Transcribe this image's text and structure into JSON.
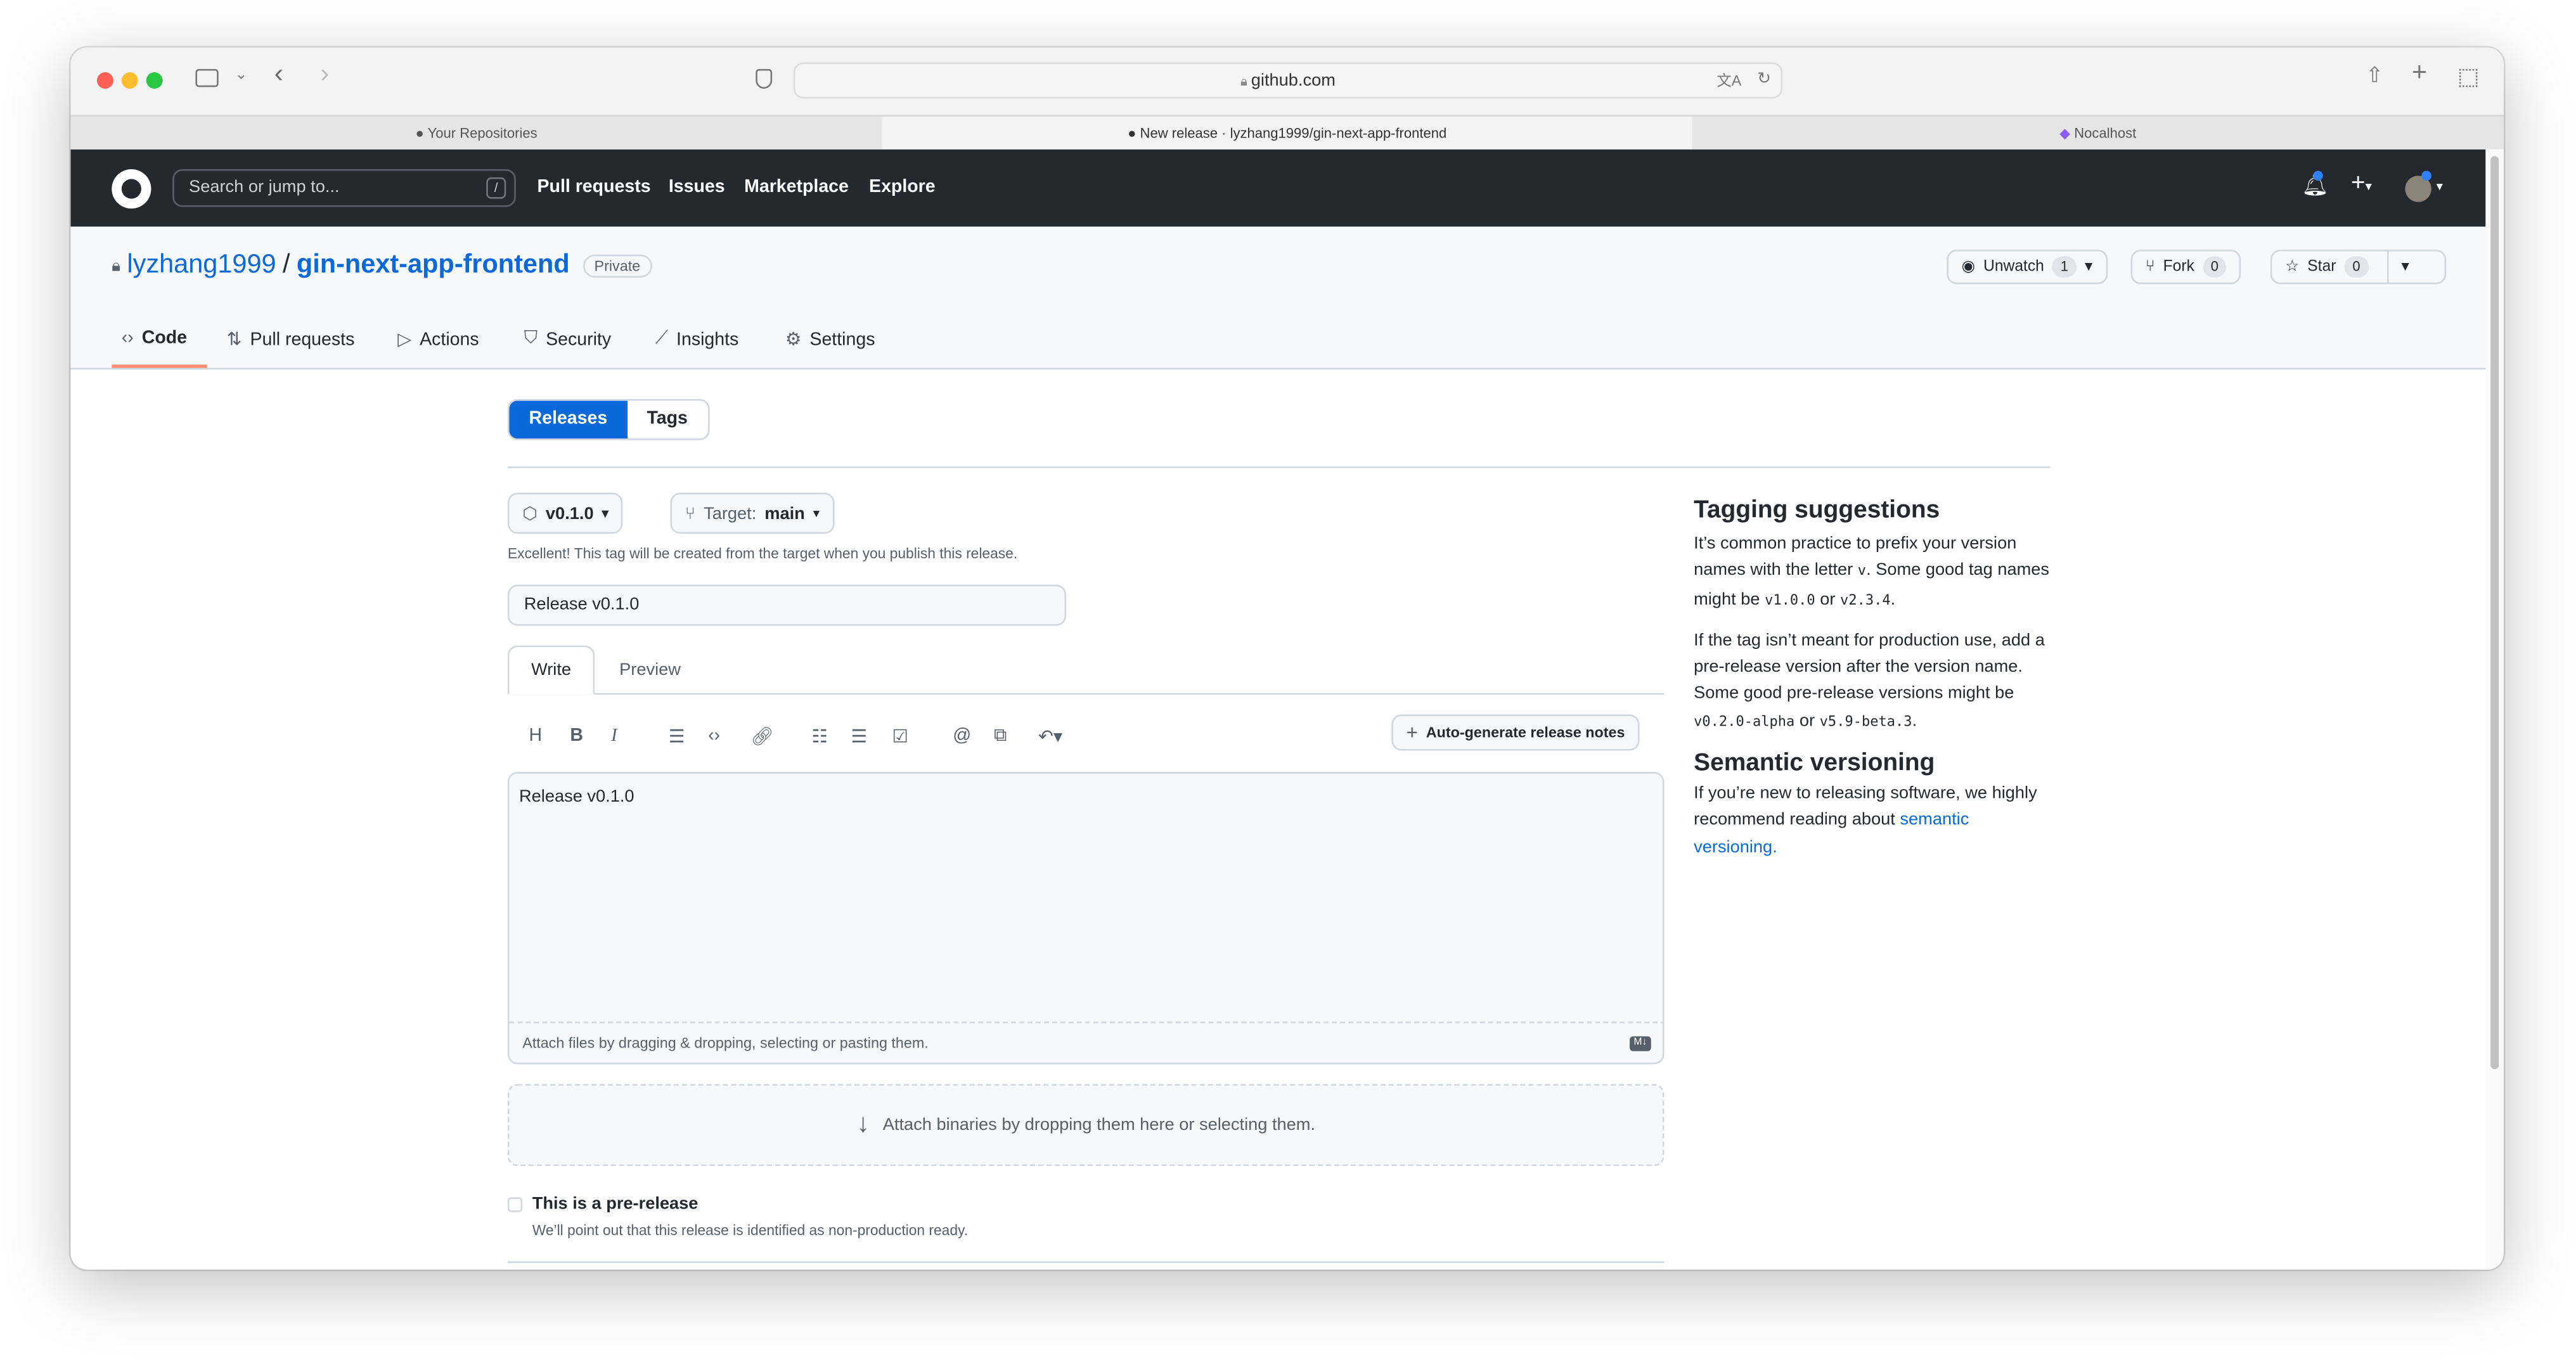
{
  "browser": {
    "url": "github.com",
    "tabs": [
      {
        "label": "Your Repositories"
      },
      {
        "label": "New release · lyzhang1999/gin-next-app-frontend",
        "active": true
      },
      {
        "label": "Nocalhost"
      }
    ]
  },
  "header": {
    "search_placeholder": "Search or jump to...",
    "slash": "/",
    "nav": [
      "Pull requests",
      "Issues",
      "Marketplace",
      "Explore"
    ]
  },
  "repo": {
    "owner": "lyzhang1999",
    "sep": "/",
    "name": "gin-next-app-frontend",
    "visibility": "Private",
    "unwatch": {
      "label": "Unwatch",
      "count": "1"
    },
    "fork": {
      "label": "Fork",
      "count": "0"
    },
    "star": {
      "label": "Star",
      "count": "0"
    },
    "tabs": [
      "Code",
      "Pull requests",
      "Actions",
      "Security",
      "Insights",
      "Settings"
    ],
    "active_tab": "Code"
  },
  "subnav": {
    "releases": "Releases",
    "tags": "Tags"
  },
  "form": {
    "tag": "v0.1.0",
    "target_label": "Target:",
    "target": "main",
    "tag_note": "Excellent! This tag will be created from the target when you publish this release.",
    "title_value": "Release v0.1.0",
    "write": "Write",
    "preview": "Preview",
    "auto_notes": "Auto-generate release notes",
    "body_value": "Release v0.1.0",
    "attach_files": "Attach files by dragging & dropping, selecting or pasting them.",
    "attach_binaries": "Attach binaries by dropping them here or selecting them.",
    "prerelease_label": "This is a pre-release",
    "prerelease_checked": false,
    "prerelease_note": "We’ll point out that this release is identified as non-production ready."
  },
  "sidebar": {
    "h1": "Tagging suggestions",
    "p1a": "It’s common practice to prefix your version names with the letter ",
    "p1code1": "v",
    "p1b": ". Some good tag names might be ",
    "p1code2": "v1.0.0",
    "p1c": " or ",
    "p1code3": "v2.3.4",
    "p1d": ".",
    "p2a": "If the tag isn’t meant for production use, add a pre-release version after the version name. Some good pre-release versions might be ",
    "p2code1": "v0.2.0-alpha",
    "p2b": " or ",
    "p2code2": "v5.9-beta.3",
    "p2c": ".",
    "h2": "Semantic versioning",
    "p3a": "If you’re new to releasing software, we highly recommend reading about ",
    "p3link": "semantic versioning."
  },
  "colors": {
    "accent": "#0969da",
    "header_bg": "#24292f",
    "tab_underline": "#fd8c73"
  }
}
